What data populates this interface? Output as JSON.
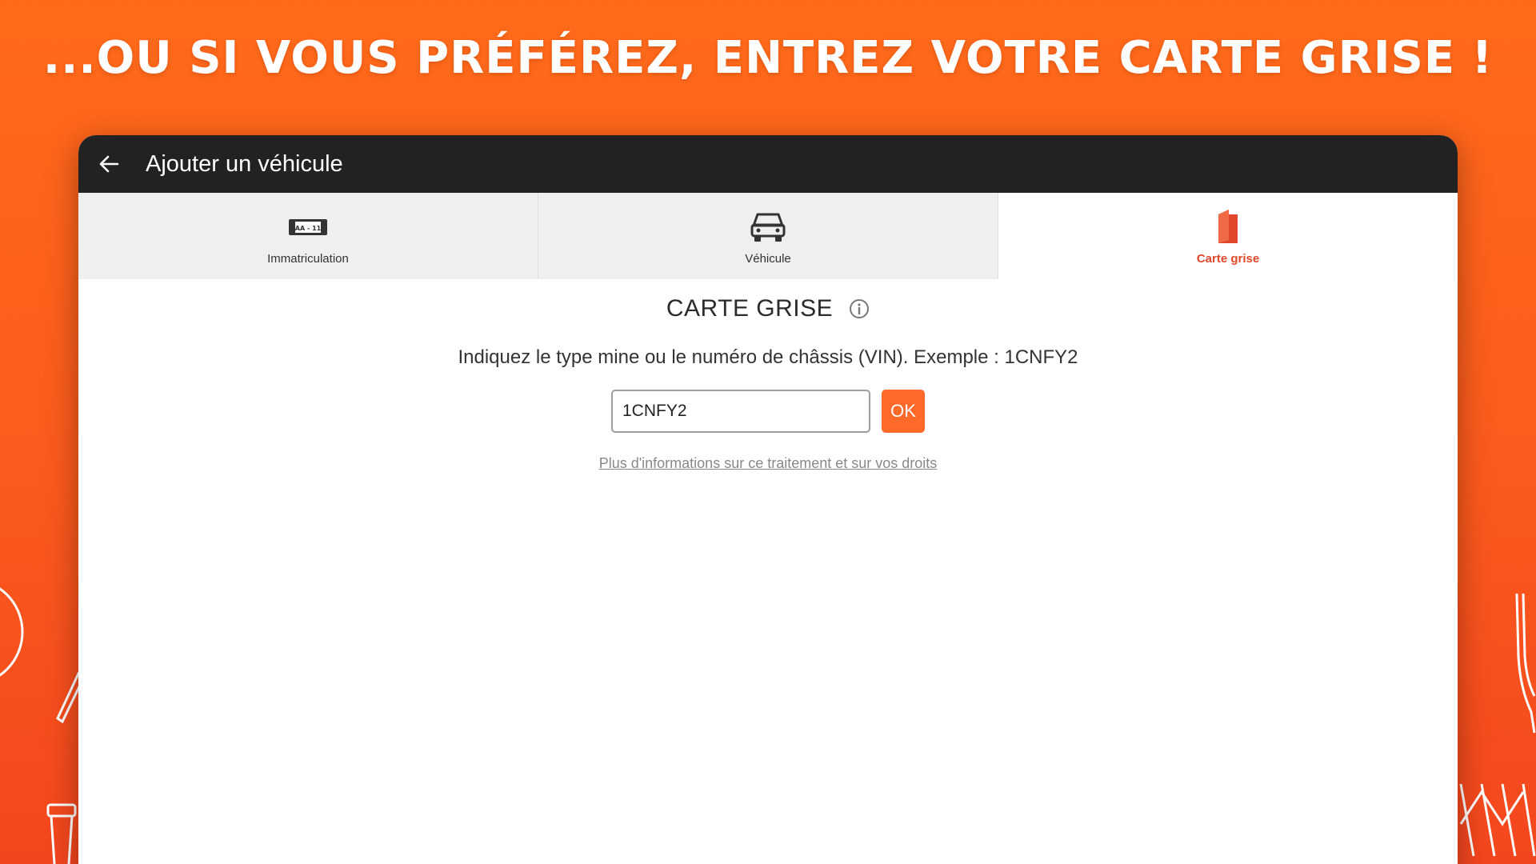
{
  "headline": "...OU SI VOUS PRÉFÉREZ, ENTREZ VOTRE CARTE GRISE !",
  "appbar": {
    "back_icon": "arrow-left-icon",
    "title": "Ajouter un véhicule"
  },
  "tabs": [
    {
      "label": "Immatriculation",
      "icon": "license-plate-icon",
      "plate_text": "AA - 11",
      "active": false
    },
    {
      "label": "Véhicule",
      "icon": "car-icon",
      "active": false
    },
    {
      "label": "Carte grise",
      "icon": "registration-card-icon",
      "active": true
    }
  ],
  "section": {
    "title": "CARTE GRISE",
    "info_icon": "info-icon",
    "instruction": "Indiquez le type mine ou le numéro de châssis (VIN). Exemple : 1CNFY2",
    "input_value": "1CNFY2",
    "ok_label": "OK",
    "privacy_link": "Plus d'informations sur ce traitement et sur vos droits"
  },
  "colors": {
    "brand_orange": "#ff6a2b",
    "active_tab": "#e1472a",
    "appbar": "#222222"
  }
}
